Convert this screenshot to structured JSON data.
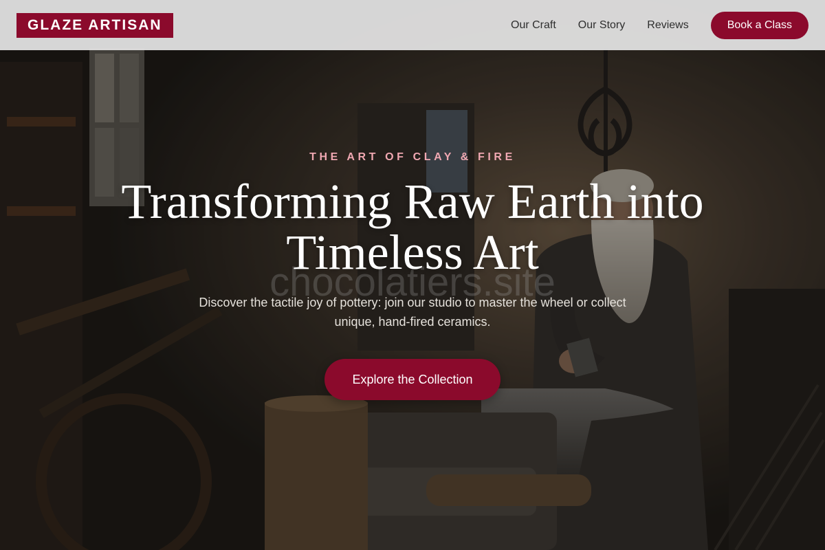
{
  "header": {
    "logo": "GLAZE ARTISAN",
    "nav": [
      {
        "label": "Our Craft"
      },
      {
        "label": "Our Story"
      },
      {
        "label": "Reviews"
      }
    ],
    "cta_label": "Book a Class"
  },
  "hero": {
    "eyebrow": "THE ART OF CLAY & FIRE",
    "headline_line1": "Transforming Raw Earth into",
    "headline_line2": "Timeless Art",
    "watermark": "chocolatiers.site",
    "subtext_line1": "Discover the tactile joy of pottery: join our studio to master the wheel or collect",
    "subtext_line2": "unique, hand-fired ceramics.",
    "cta_label": "Explore the Collection"
  },
  "colors": {
    "brand": "#8b0a2c",
    "eyebrow": "#f0a8b2",
    "header_bg": "#e2e2e2"
  }
}
